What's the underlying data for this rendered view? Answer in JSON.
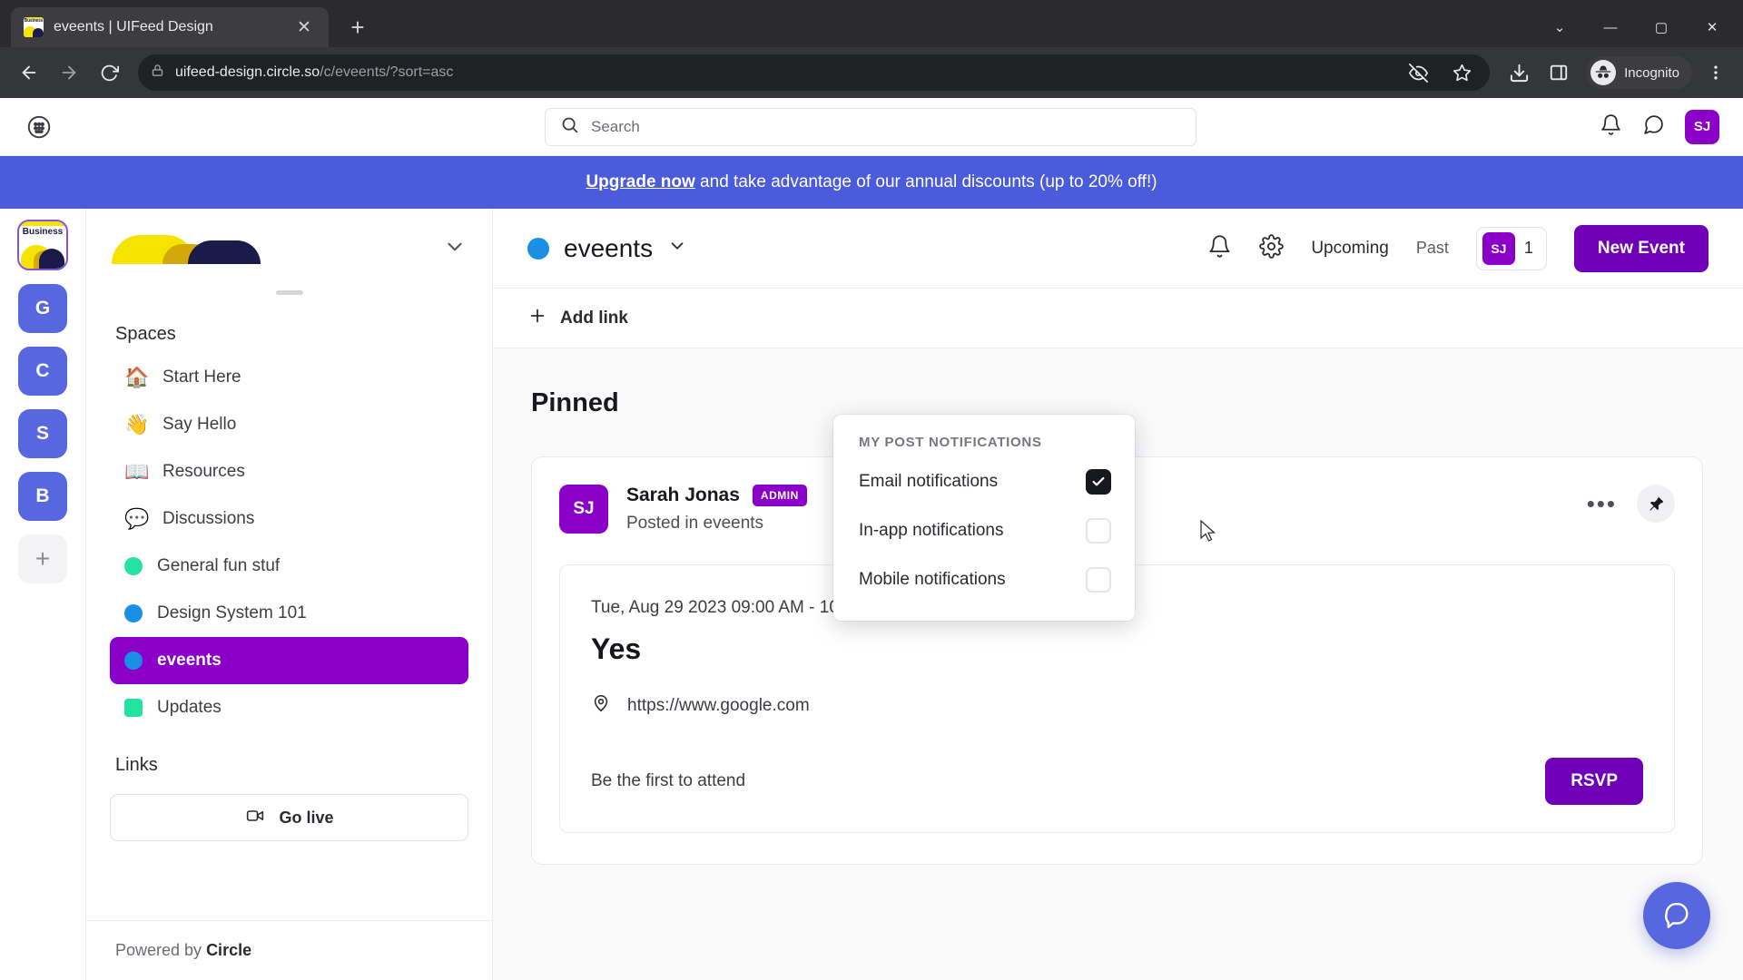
{
  "browser": {
    "tab_title": "eveents | UIFeed Design",
    "close_label": "✕",
    "new_tab_label": "+",
    "url_domain": "uifeed-design.circle.so",
    "url_path": "/c/eveents/?sort=asc",
    "profile_label": "Incognito",
    "window_minimize": "—",
    "window_maximize": "▢",
    "window_close": "✕",
    "window_chevron": "⌄",
    "icons": {
      "back": "back-arrow-icon",
      "forward": "forward-arrow-icon",
      "reload": "reload-icon",
      "lock": "lock-icon",
      "tracking_off": "eye-slash-icon",
      "bookmark": "star-icon",
      "download": "download-icon",
      "sidepanel": "side-panel-icon",
      "menu": "kebab-menu-icon"
    }
  },
  "topbar": {
    "grid_icon": "app-grid-icon",
    "search_placeholder": "Search",
    "notifications_icon": "bell-icon",
    "messages_icon": "chat-bubble-icon",
    "avatar_initials": "SJ"
  },
  "banner": {
    "link_text": "Upgrade now",
    "message": " and take advantage of our annual discounts (up to 20% off!)",
    "color": "#4a5bdc"
  },
  "rail": {
    "community_name": "Business",
    "items": [
      {
        "label": "G"
      },
      {
        "label": "C"
      },
      {
        "label": "S"
      },
      {
        "label": "B"
      }
    ],
    "add_label": "+"
  },
  "sidebar": {
    "chevron": "⌄",
    "spaces_heading": "Spaces",
    "spaces": [
      {
        "label": "Start Here",
        "emoji": "🏠",
        "type": "emoji",
        "active": false
      },
      {
        "label": "Say Hello",
        "emoji": "👋",
        "type": "emoji",
        "active": false
      },
      {
        "label": "Resources",
        "emoji": "📖",
        "type": "emoji",
        "active": false
      },
      {
        "label": "Discussions",
        "emoji": "💬",
        "type": "emoji",
        "active": false
      },
      {
        "label": "General fun stuf",
        "color": "#23e3a0",
        "type": "dot",
        "active": false
      },
      {
        "label": "Design System 101",
        "color": "#1a8fe3",
        "type": "dot",
        "active": false
      },
      {
        "label": "eveents",
        "color": "#1a8fe3",
        "type": "dot",
        "active": true
      },
      {
        "label": "Updates",
        "color": "#23e3a0",
        "type": "square",
        "active": false
      }
    ],
    "links_heading": "Links",
    "go_live_label": "Go live",
    "go_live_icon": "video-camera-icon",
    "powered_prefix": "Powered by ",
    "powered_brand": "Circle"
  },
  "main": {
    "space_dot_color": "#1a8fe3",
    "space_title": "eveents",
    "space_chevron": "⌄",
    "bell_icon": "bell-icon",
    "gear_icon": "settings-gear-icon",
    "tab_upcoming": "Upcoming",
    "tab_past": "Past",
    "member_initials": "SJ",
    "member_count": "1",
    "new_event_label": "New Event",
    "add_link_label": "Add link",
    "add_link_icon": "plus-icon",
    "pinned_heading": "Pinned"
  },
  "post": {
    "avatar_initials": "SJ",
    "author": "Sarah Jonas",
    "badge": "ADMIN",
    "posted_in": "Posted in eveents",
    "more_icon": "ellipsis-icon",
    "pin_icon": "pin-icon",
    "event": {
      "datetime": "Tue, Aug 29 2023 09:00 AM - 10:00 AM IST",
      "title": "Yes",
      "location_icon": "map-pin-icon",
      "location": "https://www.google.com",
      "attend_text": "Be the first to attend",
      "rsvp_label": "RSVP"
    }
  },
  "dropdown": {
    "heading": "MY POST NOTIFICATIONS",
    "options": [
      {
        "label": "Email notifications",
        "checked": true
      },
      {
        "label": "In-app notifications",
        "checked": false
      },
      {
        "label": "Mobile notifications",
        "checked": false
      }
    ]
  },
  "chat_fab": {
    "icon": "chat-bubble-icon",
    "color": "#5667e0"
  }
}
